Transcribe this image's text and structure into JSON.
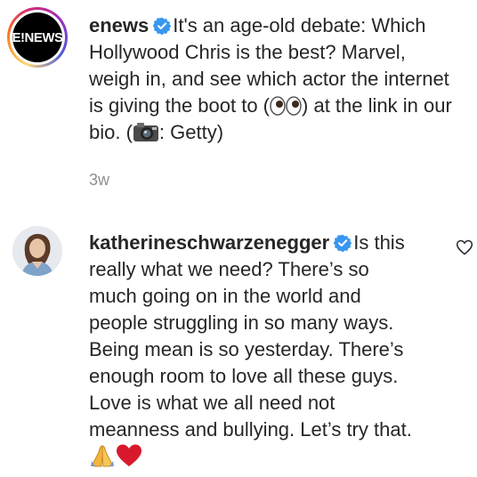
{
  "comments": [
    {
      "username": "enews",
      "avatar_text": "E!NEWS",
      "text": "It's an age-old debate: Which Hollywood Chris is the best? Marvel, weigh in, and see which actor the internet is giving the boot to (",
      "text_end": ") at the link in our bio. (",
      "text_tail": ": Getty)",
      "emoji_eyes": "eyes-emoji",
      "emoji_camera": "camera-emoji",
      "timestamp": "3w"
    },
    {
      "username": "katherineschwarzenegger",
      "text": "Is this really what we need? There’s so much going on in the world and people struggling in so many ways. Being mean is so yesterday. There’s enough room to love all these guys. Love is what we all need not meanness and bullying. Let’s try that.",
      "emoji_pray": "folded-hands-emoji",
      "emoji_heart": "red-heart-emoji"
    }
  ],
  "colors": {
    "text": "#262626",
    "muted": "#8e8e8e",
    "verified": "#3897f0",
    "heart": "#d8192d"
  }
}
